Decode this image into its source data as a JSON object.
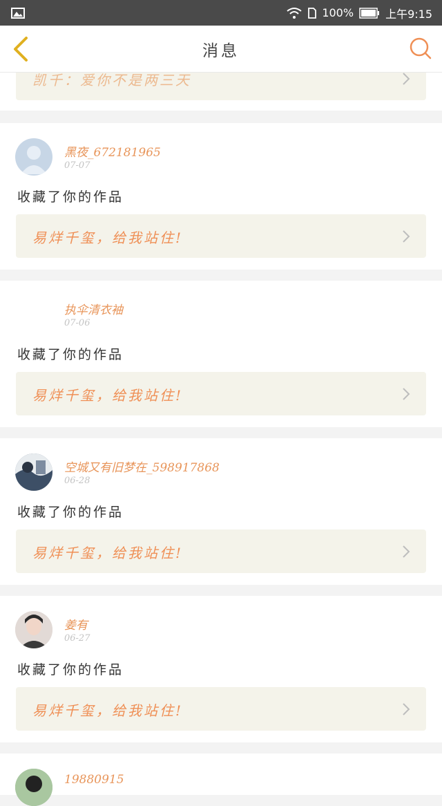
{
  "status_bar": {
    "battery_percent": "100%",
    "time": "上午9:15",
    "icons": [
      "image-icon",
      "wifi-icon",
      "sim-icon",
      "battery-icon"
    ]
  },
  "nav": {
    "title": "消息",
    "back_icon": "chevron-left-icon",
    "search_icon": "search-icon"
  },
  "colors": {
    "accent": "#ef8f55",
    "status_bar": "#4a4a4a",
    "work_box_bg": "#f4f3ea",
    "date_text": "#c3c3c3"
  },
  "partial_top_work": {
    "title": "凯千：爱你不是两三天"
  },
  "notifications": [
    {
      "username": "黑夜_672181965",
      "date": "07-07",
      "action": "收藏了你的作品",
      "work_title": "易烊千玺，给我站住!"
    },
    {
      "username": "执伞清衣袖",
      "date": "07-06",
      "action": "收藏了你的作品",
      "work_title": "易烊千玺，给我站住!"
    },
    {
      "username": "空城又有旧梦在_598917868",
      "date": "06-28",
      "action": "收藏了你的作品",
      "work_title": "易烊千玺，给我站住!"
    },
    {
      "username": "姜有",
      "date": "06-27",
      "action": "收藏了你的作品",
      "work_title": "易烊千玺，给我站住!"
    },
    {
      "username": "19880915"
    }
  ]
}
